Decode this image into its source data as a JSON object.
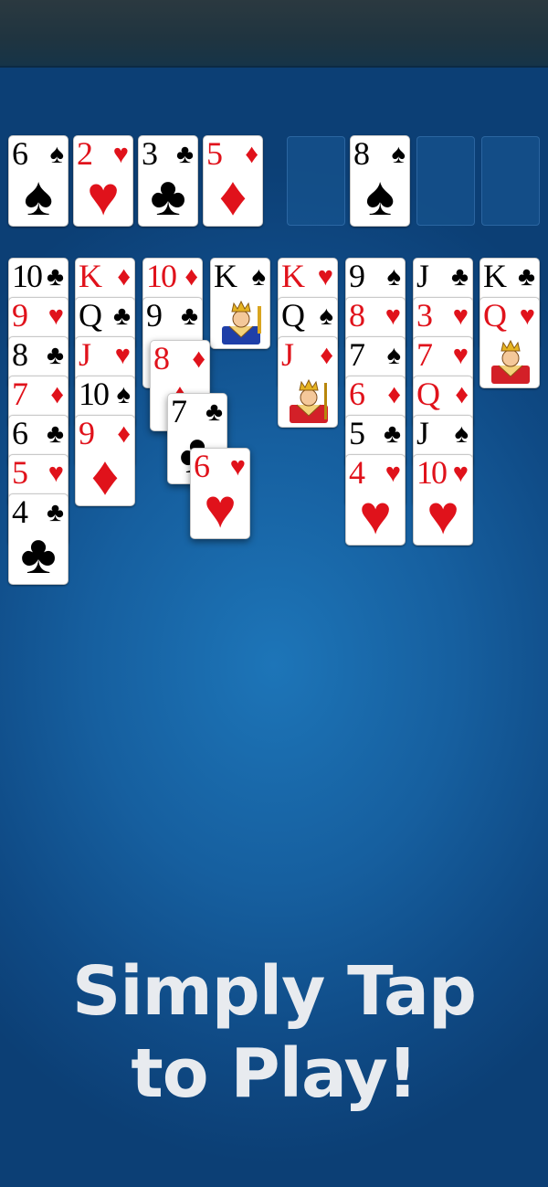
{
  "tagline": {
    "line1": "Simply Tap",
    "line2": "to Play!"
  },
  "colors": {
    "red": "#e0121b",
    "black": "#000000",
    "table": "#165f9f"
  },
  "suit_symbols": {
    "spades": "♠",
    "hearts": "♥",
    "clubs": "♣",
    "diamonds": "♦"
  },
  "foundations": [
    {
      "rank": "6",
      "suit": "spades",
      "symbol": "♠"
    },
    {
      "rank": "2",
      "suit": "hearts",
      "symbol": "♥"
    },
    {
      "rank": "3",
      "suit": "clubs",
      "symbol": "♣"
    },
    {
      "rank": "5",
      "suit": "diamonds",
      "symbol": "♦"
    }
  ],
  "free_cells": [
    {
      "rank": "",
      "suit": "",
      "symbol": ""
    },
    {
      "rank": "8",
      "suit": "spades",
      "symbol": "♠"
    },
    {
      "rank": "",
      "suit": "",
      "symbol": ""
    },
    {
      "rank": "",
      "suit": "",
      "symbol": ""
    }
  ],
  "tableau": [
    [
      {
        "rank": "10",
        "suit": "clubs",
        "symbol": "♣"
      },
      {
        "rank": "9",
        "suit": "hearts",
        "symbol": "♥"
      },
      {
        "rank": "8",
        "suit": "clubs",
        "symbol": "♣"
      },
      {
        "rank": "7",
        "suit": "diamonds",
        "symbol": "♦"
      },
      {
        "rank": "6",
        "suit": "clubs",
        "symbol": "♣"
      },
      {
        "rank": "5",
        "suit": "hearts",
        "symbol": "♥"
      },
      {
        "rank": "4",
        "suit": "clubs",
        "symbol": "♣"
      }
    ],
    [
      {
        "rank": "K",
        "suit": "diamonds",
        "symbol": "♦"
      },
      {
        "rank": "Q",
        "suit": "clubs",
        "symbol": "♣"
      },
      {
        "rank": "J",
        "suit": "hearts",
        "symbol": "♥"
      },
      {
        "rank": "10",
        "suit": "spades",
        "symbol": "♠"
      },
      {
        "rank": "9",
        "suit": "diamonds",
        "symbol": "♦"
      }
    ],
    [
      {
        "rank": "10",
        "suit": "diamonds",
        "symbol": "♦"
      },
      {
        "rank": "9",
        "suit": "clubs",
        "symbol": "♣"
      }
    ],
    [
      {
        "rank": "K",
        "suit": "spades",
        "symbol": "♠"
      }
    ],
    [
      {
        "rank": "K",
        "suit": "hearts",
        "symbol": "♥"
      },
      {
        "rank": "Q",
        "suit": "spades",
        "symbol": "♠"
      },
      {
        "rank": "J",
        "suit": "diamonds",
        "symbol": "♦"
      }
    ],
    [
      {
        "rank": "9",
        "suit": "spades",
        "symbol": "♠"
      },
      {
        "rank": "8",
        "suit": "hearts",
        "symbol": "♥"
      },
      {
        "rank": "7",
        "suit": "spades",
        "symbol": "♠"
      },
      {
        "rank": "6",
        "suit": "diamonds",
        "symbol": "♦"
      },
      {
        "rank": "5",
        "suit": "clubs",
        "symbol": "♣"
      },
      {
        "rank": "4",
        "suit": "hearts",
        "symbol": "♥"
      }
    ],
    [
      {
        "rank": "J",
        "suit": "clubs",
        "symbol": "♣"
      },
      {
        "rank": "3",
        "suit": "hearts",
        "symbol": "♥"
      },
      {
        "rank": "7",
        "suit": "hearts",
        "symbol": "♥"
      },
      {
        "rank": "Q",
        "suit": "diamonds",
        "symbol": "♦"
      },
      {
        "rank": "J",
        "suit": "spades",
        "symbol": "♠"
      },
      {
        "rank": "10",
        "suit": "hearts",
        "symbol": "♥"
      }
    ],
    [
      {
        "rank": "K",
        "suit": "clubs",
        "symbol": "♣"
      },
      {
        "rank": "Q",
        "suit": "hearts",
        "symbol": "♥"
      }
    ]
  ],
  "moving_cards": [
    {
      "rank": "8",
      "suit": "diamonds",
      "symbol": "♦"
    },
    {
      "rank": "7",
      "suit": "clubs",
      "symbol": "♣"
    },
    {
      "rank": "6",
      "suit": "hearts",
      "symbol": "♥"
    }
  ]
}
